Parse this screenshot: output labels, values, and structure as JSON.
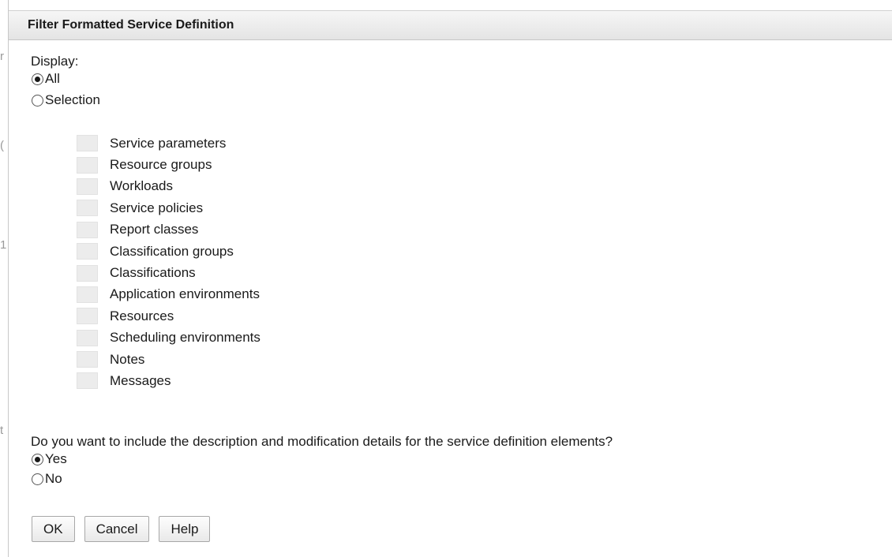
{
  "dialog": {
    "title": "Filter Formatted Service Definition"
  },
  "display": {
    "label": "Display:",
    "options": [
      {
        "label": "All",
        "checked": true
      },
      {
        "label": "Selection",
        "checked": false
      }
    ]
  },
  "selection_items": [
    {
      "label": "Service parameters",
      "checked": false
    },
    {
      "label": "Resource groups",
      "checked": false
    },
    {
      "label": "Workloads",
      "checked": false
    },
    {
      "label": "Service policies",
      "checked": false
    },
    {
      "label": "Report classes",
      "checked": false
    },
    {
      "label": "Classification groups",
      "checked": false
    },
    {
      "label": "Classifications",
      "checked": false
    },
    {
      "label": "Application environments",
      "checked": false
    },
    {
      "label": "Resources",
      "checked": false
    },
    {
      "label": "Scheduling environments",
      "checked": false
    },
    {
      "label": "Notes",
      "checked": false
    },
    {
      "label": "Messages",
      "checked": false
    }
  ],
  "details_question": {
    "label": "Do you want to include the description and modification details for the service definition elements?",
    "options": [
      {
        "label": "Yes",
        "checked": true
      },
      {
        "label": "No",
        "checked": false
      }
    ]
  },
  "buttons": {
    "ok": "OK",
    "cancel": "Cancel",
    "help": "Help"
  },
  "colors": {
    "title_bar": "#e9e9e9",
    "checkbox_disabled": "#ececec"
  }
}
